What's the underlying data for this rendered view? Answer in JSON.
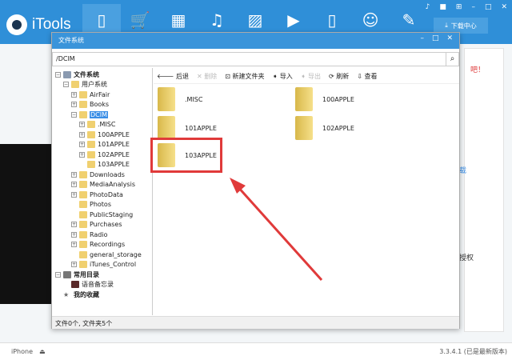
{
  "app": {
    "title": "iTools",
    "download_label": "下载中心"
  },
  "nav": [
    {
      "icon": "phone-icon",
      "glyph": "▯"
    },
    {
      "icon": "cart-icon",
      "glyph": "🛒"
    },
    {
      "icon": "apps-icon",
      "glyph": "▦"
    },
    {
      "icon": "music-icon",
      "glyph": "♫"
    },
    {
      "icon": "image-icon",
      "glyph": "▨"
    },
    {
      "icon": "video-icon",
      "glyph": "▶"
    },
    {
      "icon": "book-icon",
      "glyph": "▯"
    },
    {
      "icon": "user-icon",
      "glyph": "☺"
    },
    {
      "icon": "wrench-icon",
      "glyph": "✎"
    }
  ],
  "background": {
    "t1": "吧！",
    "t2": "载",
    "t3": "授权"
  },
  "dialog": {
    "title": "文件系统",
    "path": "/DCIM",
    "toolbar": {
      "back": "后退",
      "delete": "删除",
      "new_folder": "新建文件夹",
      "import": "导入",
      "export": "导出",
      "refresh": "刷新",
      "view": "查看"
    },
    "tree": [
      "文件系统",
      "用户系统",
      "AirFair",
      "Books",
      "DCIM",
      ".MISC",
      "100APPLE",
      "101APPLE",
      "102APPLE",
      "103APPLE",
      "Downloads",
      "MediaAnalysis",
      "PhotoData",
      "Photos",
      "PublicStaging",
      "Purchases",
      "Radio",
      "Recordings",
      "general_storage",
      "iTunes_Control",
      "常用目录",
      "语音备忘录",
      "我的收藏"
    ],
    "files": [
      ".MISC",
      "100APPLE",
      "101APPLE",
      "102APPLE",
      "103APPLE"
    ],
    "status": "文件0个, 文件夹5个"
  },
  "footer": {
    "device": "iPhone",
    "version": "3.3.4.1 (已是最新版本)"
  }
}
